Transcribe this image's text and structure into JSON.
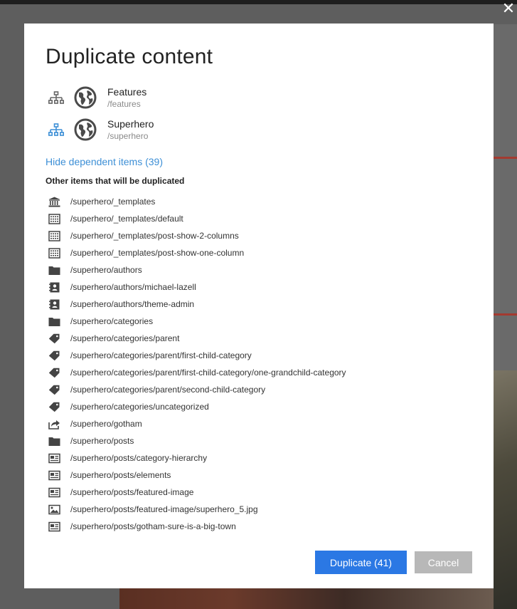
{
  "dialog": {
    "title": "Duplicate content",
    "close_icon": "close-icon",
    "sites": [
      {
        "name": "Features",
        "path": "/features",
        "tree_icon_color": "#666666"
      },
      {
        "name": "Superhero",
        "path": "/superhero",
        "tree_icon_color": "#3d8fd6"
      }
    ],
    "toggle_link": "Hide dependent items (39)",
    "section_label": "Other items that will be duplicated",
    "items": [
      {
        "icon": "library-icon",
        "path": "/superhero/_templates"
      },
      {
        "icon": "template-icon",
        "path": "/superhero/_templates/default"
      },
      {
        "icon": "template-icon",
        "path": "/superhero/_templates/post-show-2-columns"
      },
      {
        "icon": "template-icon",
        "path": "/superhero/_templates/post-show-one-column"
      },
      {
        "icon": "folder-icon",
        "path": "/superhero/authors"
      },
      {
        "icon": "contact-icon",
        "path": "/superhero/authors/michael-lazell"
      },
      {
        "icon": "contact-icon",
        "path": "/superhero/authors/theme-admin"
      },
      {
        "icon": "folder-icon",
        "path": "/superhero/categories"
      },
      {
        "icon": "tag-icon",
        "path": "/superhero/categories/parent"
      },
      {
        "icon": "tag-icon",
        "path": "/superhero/categories/parent/first-child-category"
      },
      {
        "icon": "tag-icon",
        "path": "/superhero/categories/parent/first-child-category/one-grandchild-category"
      },
      {
        "icon": "tag-icon",
        "path": "/superhero/categories/parent/second-child-category"
      },
      {
        "icon": "tag-icon",
        "path": "/superhero/categories/uncategorized"
      },
      {
        "icon": "shortcut-icon",
        "path": "/superhero/gotham"
      },
      {
        "icon": "folder-icon",
        "path": "/superhero/posts"
      },
      {
        "icon": "article-icon",
        "path": "/superhero/posts/category-hierarchy"
      },
      {
        "icon": "article-icon",
        "path": "/superhero/posts/elements"
      },
      {
        "icon": "article-icon",
        "path": "/superhero/posts/featured-image"
      },
      {
        "icon": "image-icon",
        "path": "/superhero/posts/featured-image/superhero_5.jpg"
      },
      {
        "icon": "article-icon",
        "path": "/superhero/posts/gotham-sure-is-a-big-town"
      }
    ],
    "buttons": {
      "duplicate": "Duplicate (41)",
      "cancel": "Cancel"
    },
    "colors": {
      "primary_button": "#2b78e4",
      "secondary_button": "#b8b8b8",
      "link": "#3d8fd6"
    }
  }
}
